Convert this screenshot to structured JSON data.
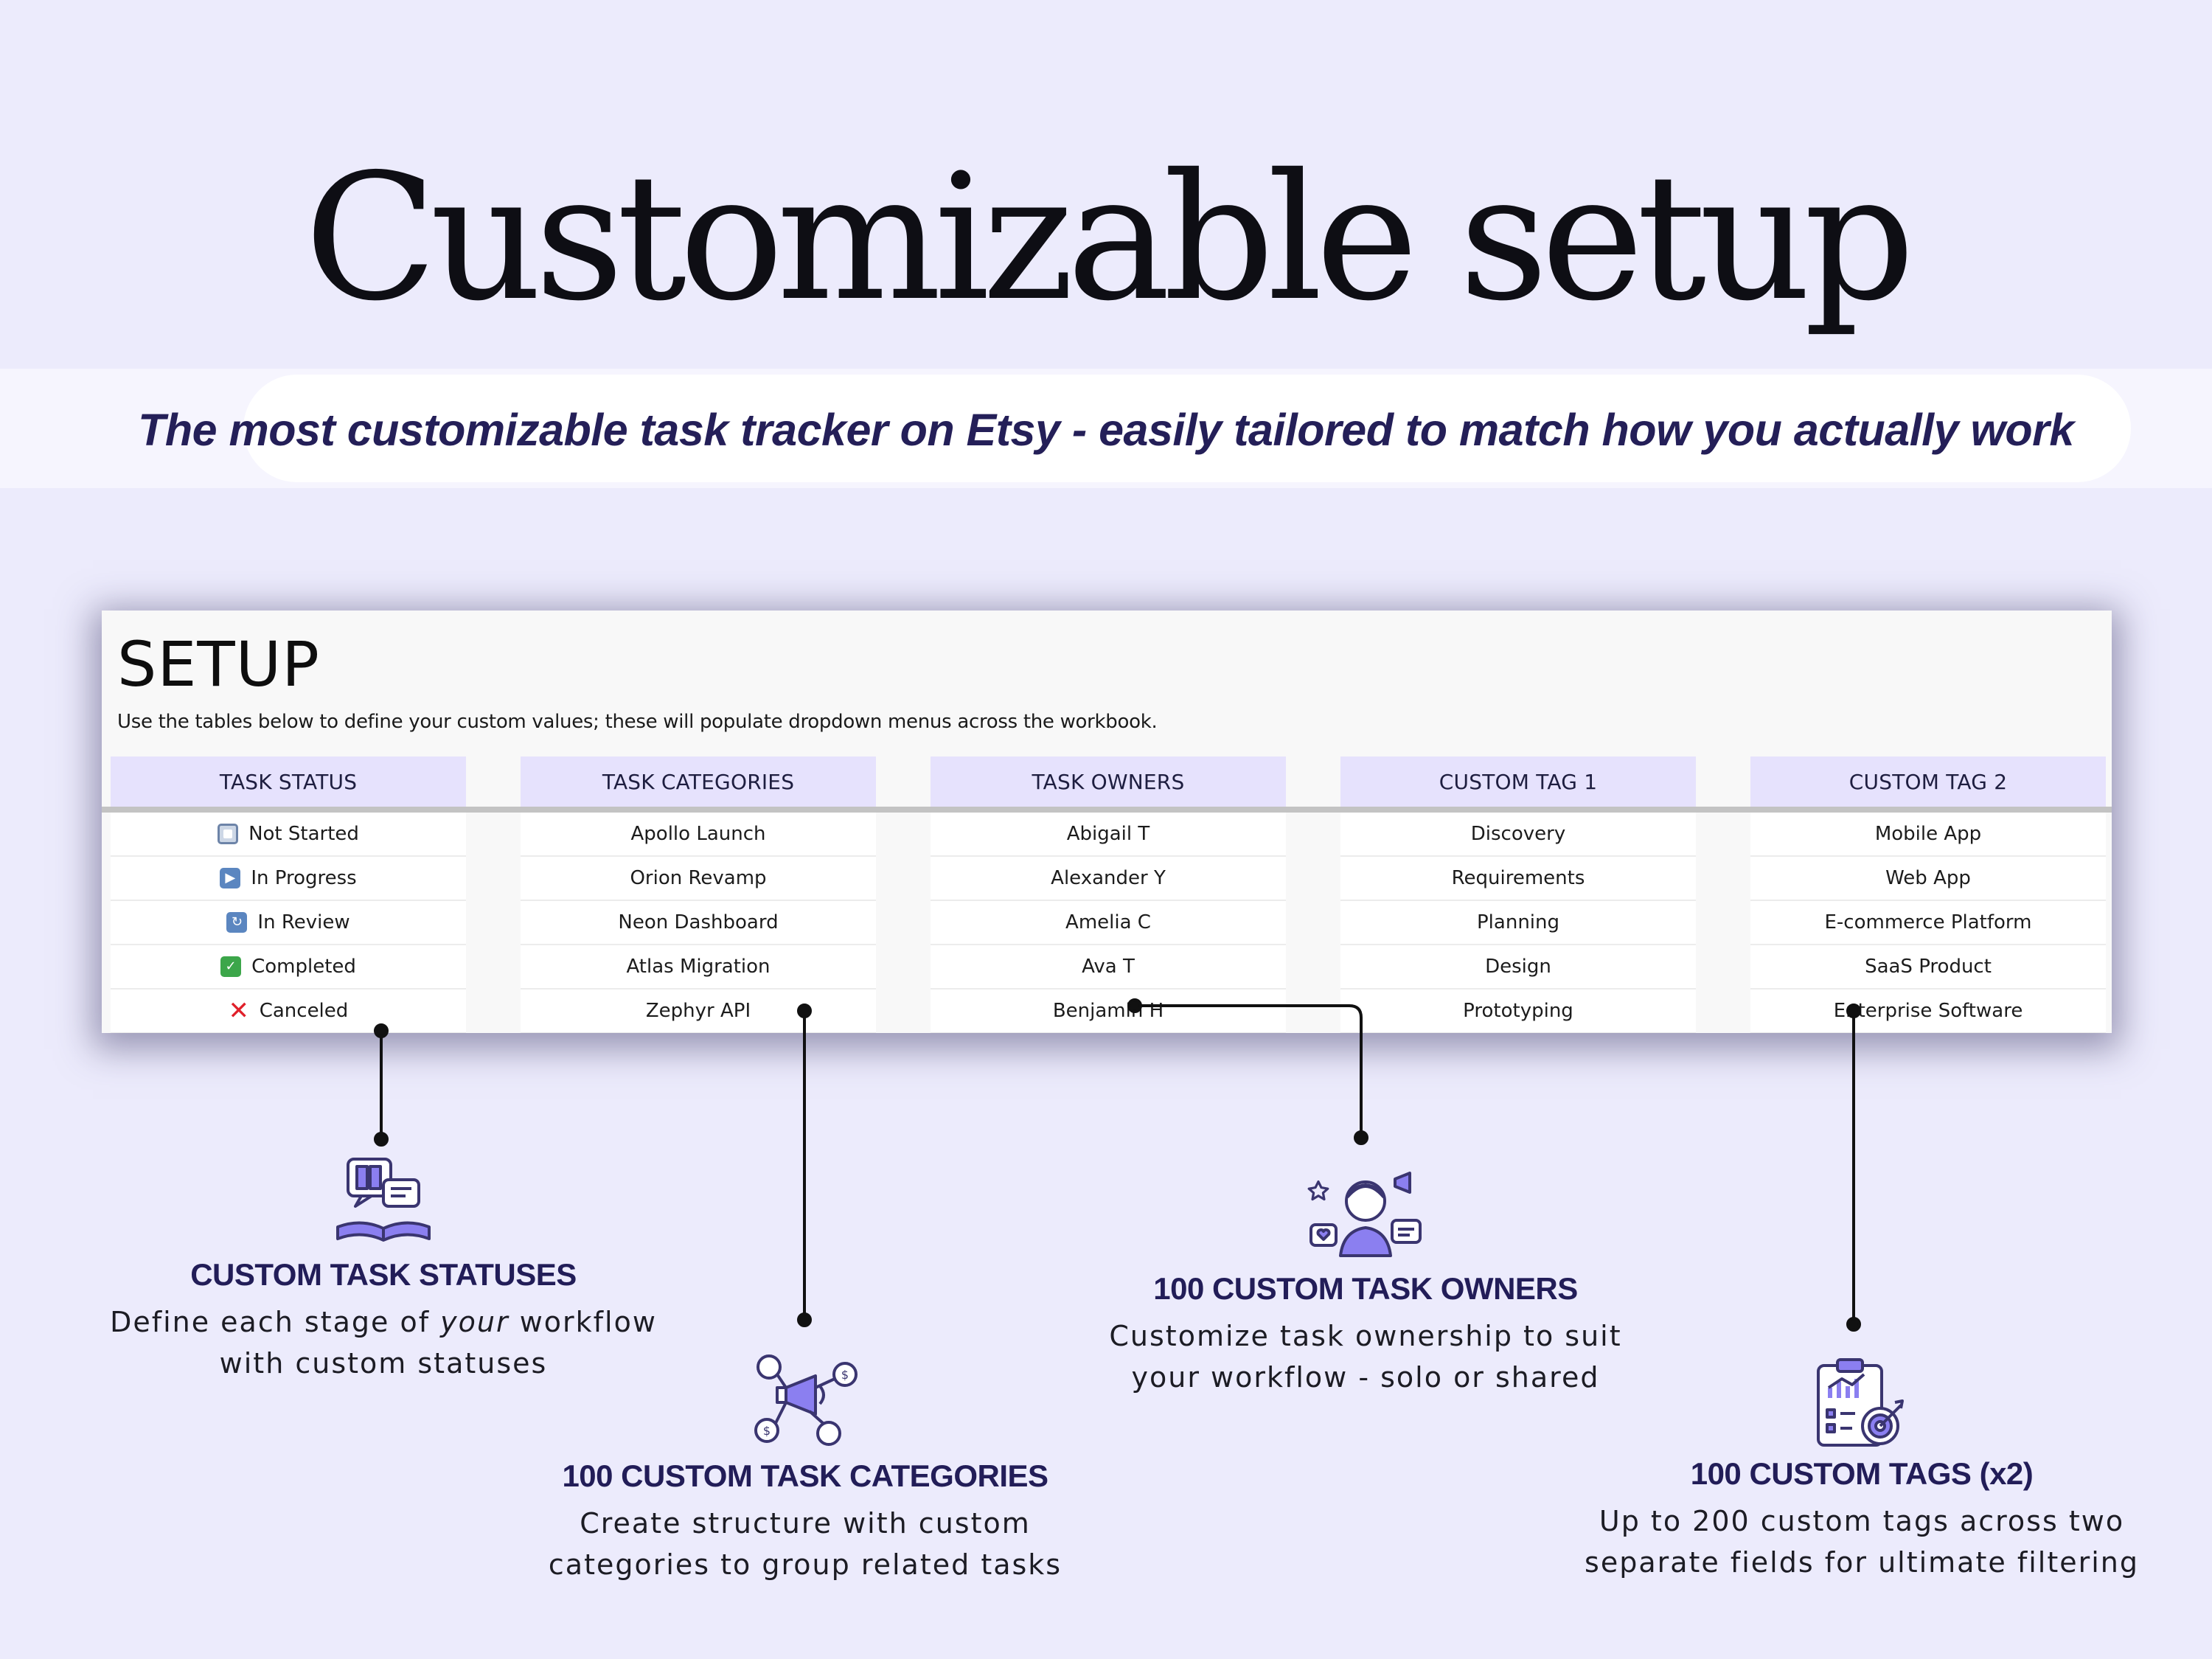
{
  "page": {
    "title": "Customizable setup",
    "tagline": "The most customizable task tracker on Etsy - easily tailored to match how you actually work"
  },
  "sheet": {
    "title": "SETUP",
    "description": "Use the tables below to define your custom values; these will populate dropdown menus across the workbook.",
    "columns": [
      {
        "header": "TASK STATUS",
        "rows": [
          {
            "label": "Not Started",
            "icon": "not-started-icon"
          },
          {
            "label": "In Progress",
            "icon": "play-icon"
          },
          {
            "label": "In Review",
            "icon": "repeat-icon"
          },
          {
            "label": "Completed",
            "icon": "check-icon"
          },
          {
            "label": "Canceled",
            "icon": "cross-icon"
          }
        ]
      },
      {
        "header": "TASK CATEGORIES",
        "rows": [
          {
            "label": "Apollo Launch"
          },
          {
            "label": "Orion Revamp"
          },
          {
            "label": "Neon Dashboard"
          },
          {
            "label": "Atlas Migration"
          },
          {
            "label": "Zephyr API"
          }
        ]
      },
      {
        "header": "TASK OWNERS",
        "rows": [
          {
            "label": "Abigail T"
          },
          {
            "label": "Alexander Y"
          },
          {
            "label": "Amelia C"
          },
          {
            "label": "Ava T"
          },
          {
            "label": "Benjamin H"
          }
        ]
      },
      {
        "header": "CUSTOM TAG 1",
        "rows": [
          {
            "label": "Discovery"
          },
          {
            "label": "Requirements"
          },
          {
            "label": "Planning"
          },
          {
            "label": "Design"
          },
          {
            "label": "Prototyping"
          }
        ]
      },
      {
        "header": "CUSTOM TAG 2",
        "rows": [
          {
            "label": "Mobile App"
          },
          {
            "label": "Web App"
          },
          {
            "label": "E-commerce Platform"
          },
          {
            "label": "SaaS Product"
          },
          {
            "label": "Enterprise Software"
          }
        ]
      }
    ]
  },
  "features": {
    "statuses": {
      "heading": "CUSTOM TASK STATUSES",
      "line1_pre": "Define each stage of ",
      "line1_em": "your",
      "line1_post": " workflow",
      "line2": "with custom statuses",
      "icon": "book-chat-icon"
    },
    "categories": {
      "heading": "100 CUSTOM TASK CATEGORIES",
      "line1": "Create structure with custom",
      "line2": "categories to group related tasks",
      "icon": "megaphone-network-icon"
    },
    "owners": {
      "heading": "100 CUSTOM TASK OWNERS",
      "line1": "Customize task ownership to suit",
      "line2": "your workflow - solo or shared",
      "icon": "person-social-icon"
    },
    "tags": {
      "heading": "100 CUSTOM TAGS (x2)",
      "line1": "Up to 200 custom tags across two",
      "line2": "separate fields for ultimate filtering",
      "icon": "clipboard-target-icon"
    }
  },
  "colors": {
    "background": "#ecebfc",
    "accent": "#241f58",
    "header_fill": "#e6e2fd",
    "icon_purple": "#8b7ff0"
  }
}
